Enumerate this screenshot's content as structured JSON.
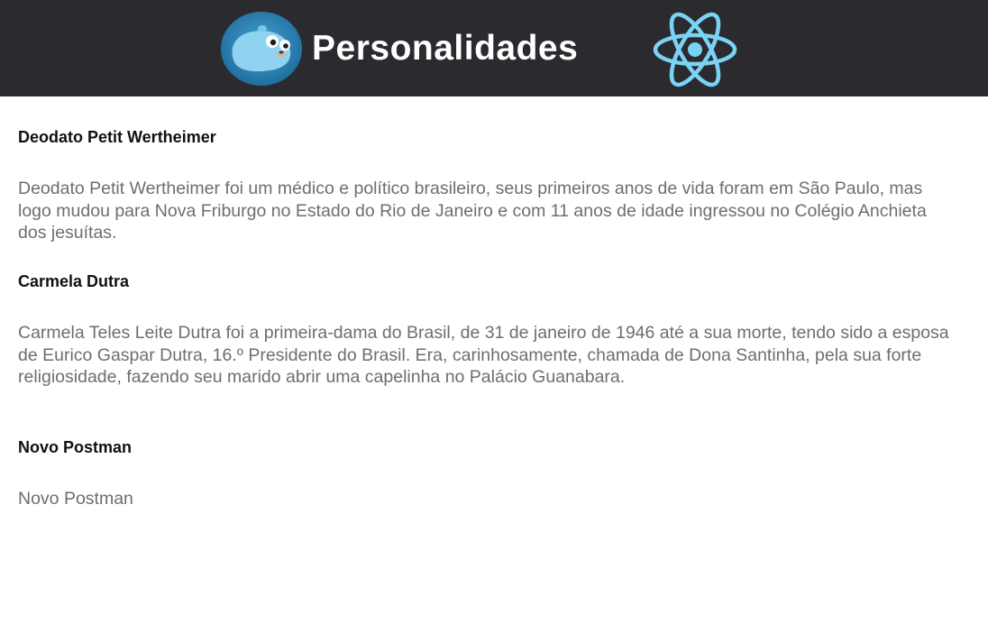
{
  "header": {
    "title": "Personalidades",
    "left_logo": "gopher-icon",
    "right_logo": "react-icon",
    "background": "#2b2b2f"
  },
  "items": [
    {
      "title": "Deodato Petit Wertheimer",
      "text": "Deodato Petit Wertheimer foi um médico e político brasileiro, seus primeiros anos de vida foram em São Paulo, mas logo mudou para Nova Friburgo no Estado do Rio de Janeiro e com 11 anos de idade ingressou no Colégio Anchieta dos jesuítas."
    },
    {
      "title": "Carmela Dutra",
      "text": "Carmela Teles Leite Dutra foi a primeira-dama do Brasil, de 31 de janeiro de 1946 até a sua morte, tendo sido a esposa de Eurico Gaspar Dutra, 16.º Presidente do Brasil. Era, carinhosamente, chamada de Dona Santinha, pela sua forte religiosidade, fazendo seu marido abrir uma capelinha no Palácio Guanabara."
    },
    {
      "title": "Novo Postman",
      "text": "Novo Postman"
    }
  ]
}
